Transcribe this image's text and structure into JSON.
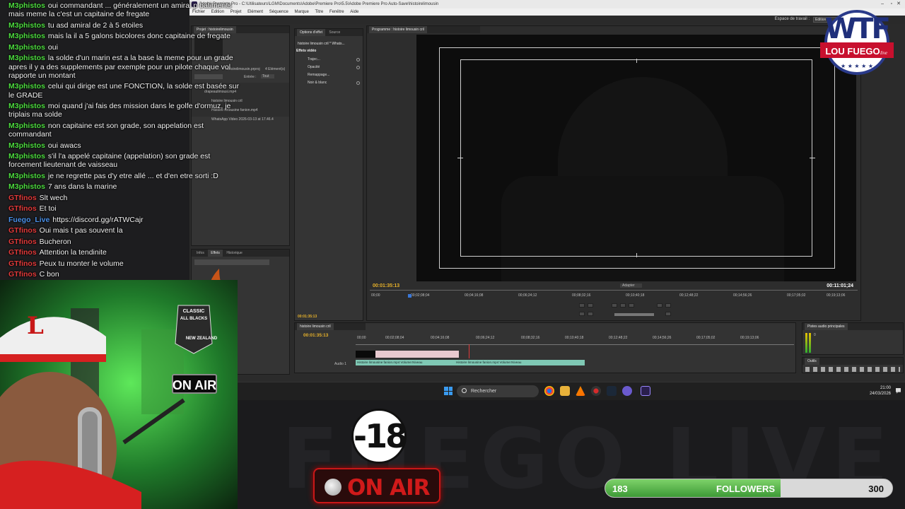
{
  "premiere": {
    "title": "Adobe Premiere Pro - C:\\Utilisateurs\\LGM\\Documents\\Adobe\\Premiere Pro\\5.5\\Adobe Premiere Pro Auto-Save\\histoirelimousin",
    "menu": [
      "Fichier",
      "Edition",
      "Projet",
      "Elément",
      "Séquence",
      "Marque",
      "Titre",
      "Fenêtre",
      "Aide"
    ],
    "workspace_label": "Espace de travail :",
    "workspace_value": "Edition",
    "project_panel": {
      "tab": "Projet : histoirelimousin",
      "file": "histoirelimousin.prproj",
      "count": "4 Elément(s)",
      "entry_label": "Entrée :",
      "entry_value": "Tout",
      "items": [
        "drapeaulimousi.mp4",
        "histoire limousin cril",
        "Histoire limousine fanion.mp4",
        "WhatsApp Video 2026-03-13 at 17.46.4"
      ]
    },
    "effects_panel": {
      "tabs": [
        "Infos",
        "Effets",
        "Historique"
      ]
    },
    "effect_controls": {
      "tabs": [
        "Options d'effet",
        "Source"
      ],
      "clip": "histoire limousin cril * Whats...",
      "header": "Effets vidéo",
      "rows": [
        "Trajec...",
        "Opacité",
        "Remappage...",
        "Noir & blanc"
      ],
      "timecode": "00:01:35:13"
    },
    "program": {
      "tab": "Programme : histoire limousin cril",
      "timecode_current": "00:01:35:13",
      "timecode_total": "00:11:01;24",
      "fit": "Adapter",
      "ruler": [
        "00;00",
        "00;02;08;04",
        "00;04;16;08",
        "00;06;24;12",
        "00;08;32;16",
        "00;10;40;18",
        "00;12;48;22",
        "00;14;56;26",
        "00;17;05;02",
        "00;19;13;06"
      ]
    },
    "timeline": {
      "tab": "histoire limousin cril",
      "timecode": "00:01:35:13",
      "ruler": [
        "00;00",
        "00;02;08;04",
        "00;04;16;08",
        "00;06;24;12",
        "00;08;32;16",
        "00;10;40;18",
        "00;12;48;22",
        "00;14;56;26",
        "00;17;05;02",
        "00;19;13;06"
      ],
      "track": "Audio 1",
      "clip1": "Histoire limousine fanion.mp4 Volume:Niveau",
      "clip2": "Histoire limousine fanion.mp4 Volume:Niveau"
    },
    "audio_master": {
      "tab": "Pistes audio principales",
      "level": "0"
    },
    "tools": {
      "tab": "Outils"
    }
  },
  "taskbar": {
    "search_placeholder": "Rechercher",
    "time": "21:00",
    "date": "24/03/2026"
  },
  "chat": [
    {
      "user": "M3phistos",
      "color": "#4ddc3f",
      "text": "oui commandant ... généralement un amiral p batiments mais meme la c'est un capitaine de fregate"
    },
    {
      "user": "M3phistos",
      "color": "#4ddc3f",
      "text": "tu asd amiral de 2 à 5 etoiles"
    },
    {
      "user": "M3phistos",
      "color": "#4ddc3f",
      "text": "mais la il a 5 galons bicolores donc capitaine de fregate"
    },
    {
      "user": "M3phistos",
      "color": "#4ddc3f",
      "text": "oui"
    },
    {
      "user": "M3phistos",
      "color": "#4ddc3f",
      "text": "la solde d'un marin est a la base la meme pour un grade apres il y a des supplements par exemple pour un pilote chaque vol rapporte un montant"
    },
    {
      "user": "M3phistos",
      "color": "#4ddc3f",
      "text": "celui qui dirige est une FONCTION, la solde est basée sur le GRADE"
    },
    {
      "user": "M3phistos",
      "color": "#4ddc3f",
      "text": "moi quand j'ai fais des mission dans le golfe d'ormuz, je triplais ma solde"
    },
    {
      "user": "M3phistos",
      "color": "#4ddc3f",
      "text": "non capitaine est son grade, son appelation est commandant"
    },
    {
      "user": "M3phistos",
      "color": "#4ddc3f",
      "text": "oui awacs"
    },
    {
      "user": "M3phistos",
      "color": "#4ddc3f",
      "text": "s'il l'a appelé capitaine (appelation) son grade est forcement lieutenant de vaisseau"
    },
    {
      "user": "M3phistos",
      "color": "#4ddc3f",
      "text": "je ne regrette pas d'y etre allé ... et d'en etre sorti :D"
    },
    {
      "user": "M3phistos",
      "color": "#4ddc3f",
      "text": "7 ans dans la marine"
    },
    {
      "user": "GTfinos",
      "color": "#e23a3a",
      "text": "Slt wech"
    },
    {
      "user": "GTfinos",
      "color": "#e23a3a",
      "text": "Et toi"
    },
    {
      "user": "Fuego_Live",
      "color": "#4a90e8",
      "text": "https://discord.gg/rATWCajr"
    },
    {
      "user": "GTfinos",
      "color": "#e23a3a",
      "text": "Oui mais t pas souvent la"
    },
    {
      "user": "GTfinos",
      "color": "#e23a3a",
      "text": "Bucheron"
    },
    {
      "user": "GTfinos",
      "color": "#e23a3a",
      "text": "Attention la tendinite"
    },
    {
      "user": "GTfinos",
      "color": "#e23a3a",
      "text": "Peux tu monter le volume"
    },
    {
      "user": "GTfinos",
      "color": "#e23a3a",
      "text": "C bon"
    }
  ],
  "webcam": {
    "sign_onair": "ON AIR",
    "sign_classic": "CLASSIC",
    "sign_allblacks": "ALL BLACKS",
    "sign_nz": "NEW ZEALAND",
    "cap_letter": "L"
  },
  "overlay": {
    "watermark": "FUEGO LIVE",
    "age_rating": "-18",
    "on_air": "ON AIR",
    "followers": {
      "current": "183",
      "label": "FOLLOWERS",
      "goal": "300",
      "progress": 0.61
    },
    "logo_top": "WTF",
    "logo_bottom": "LOU FUEGO",
    "logo_tag": "live"
  },
  "colors": {
    "accent_green": "#4ddc3f",
    "accent_red": "#e23a3a",
    "timecode_yellow": "#e8b22a",
    "timecode_white": "#ffffff"
  }
}
